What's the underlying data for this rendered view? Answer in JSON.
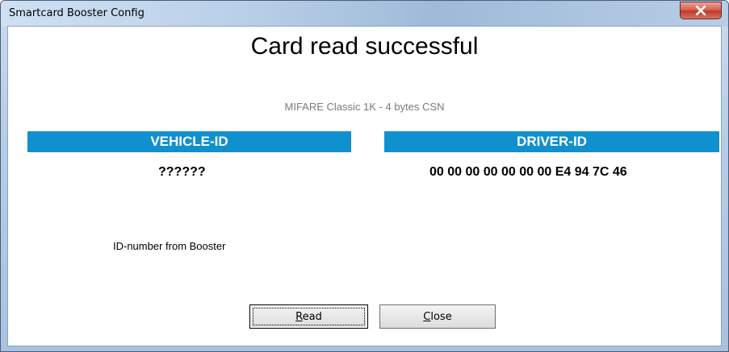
{
  "window": {
    "title": "Smartcard Booster Config"
  },
  "main": {
    "heading": "Card read successful",
    "card_type": "MIFARE Classic 1K - 4 bytes CSN",
    "vehicle": {
      "header": "VEHICLE-ID",
      "value": "??????"
    },
    "driver": {
      "header": "DRIVER-ID",
      "value": "00 00 00 00 00 00 00 E4 94 7C 46"
    },
    "note": "ID-number from Booster"
  },
  "buttons": {
    "read": {
      "mnemonic": "R",
      "rest": "ead"
    },
    "close": {
      "mnemonic": "C",
      "rest": "lose"
    }
  },
  "colors": {
    "header_bg": "#0f90cf",
    "header_text": "#ffffff",
    "close_button": "#c0392b"
  },
  "icons": {
    "window_close": "close-icon"
  }
}
